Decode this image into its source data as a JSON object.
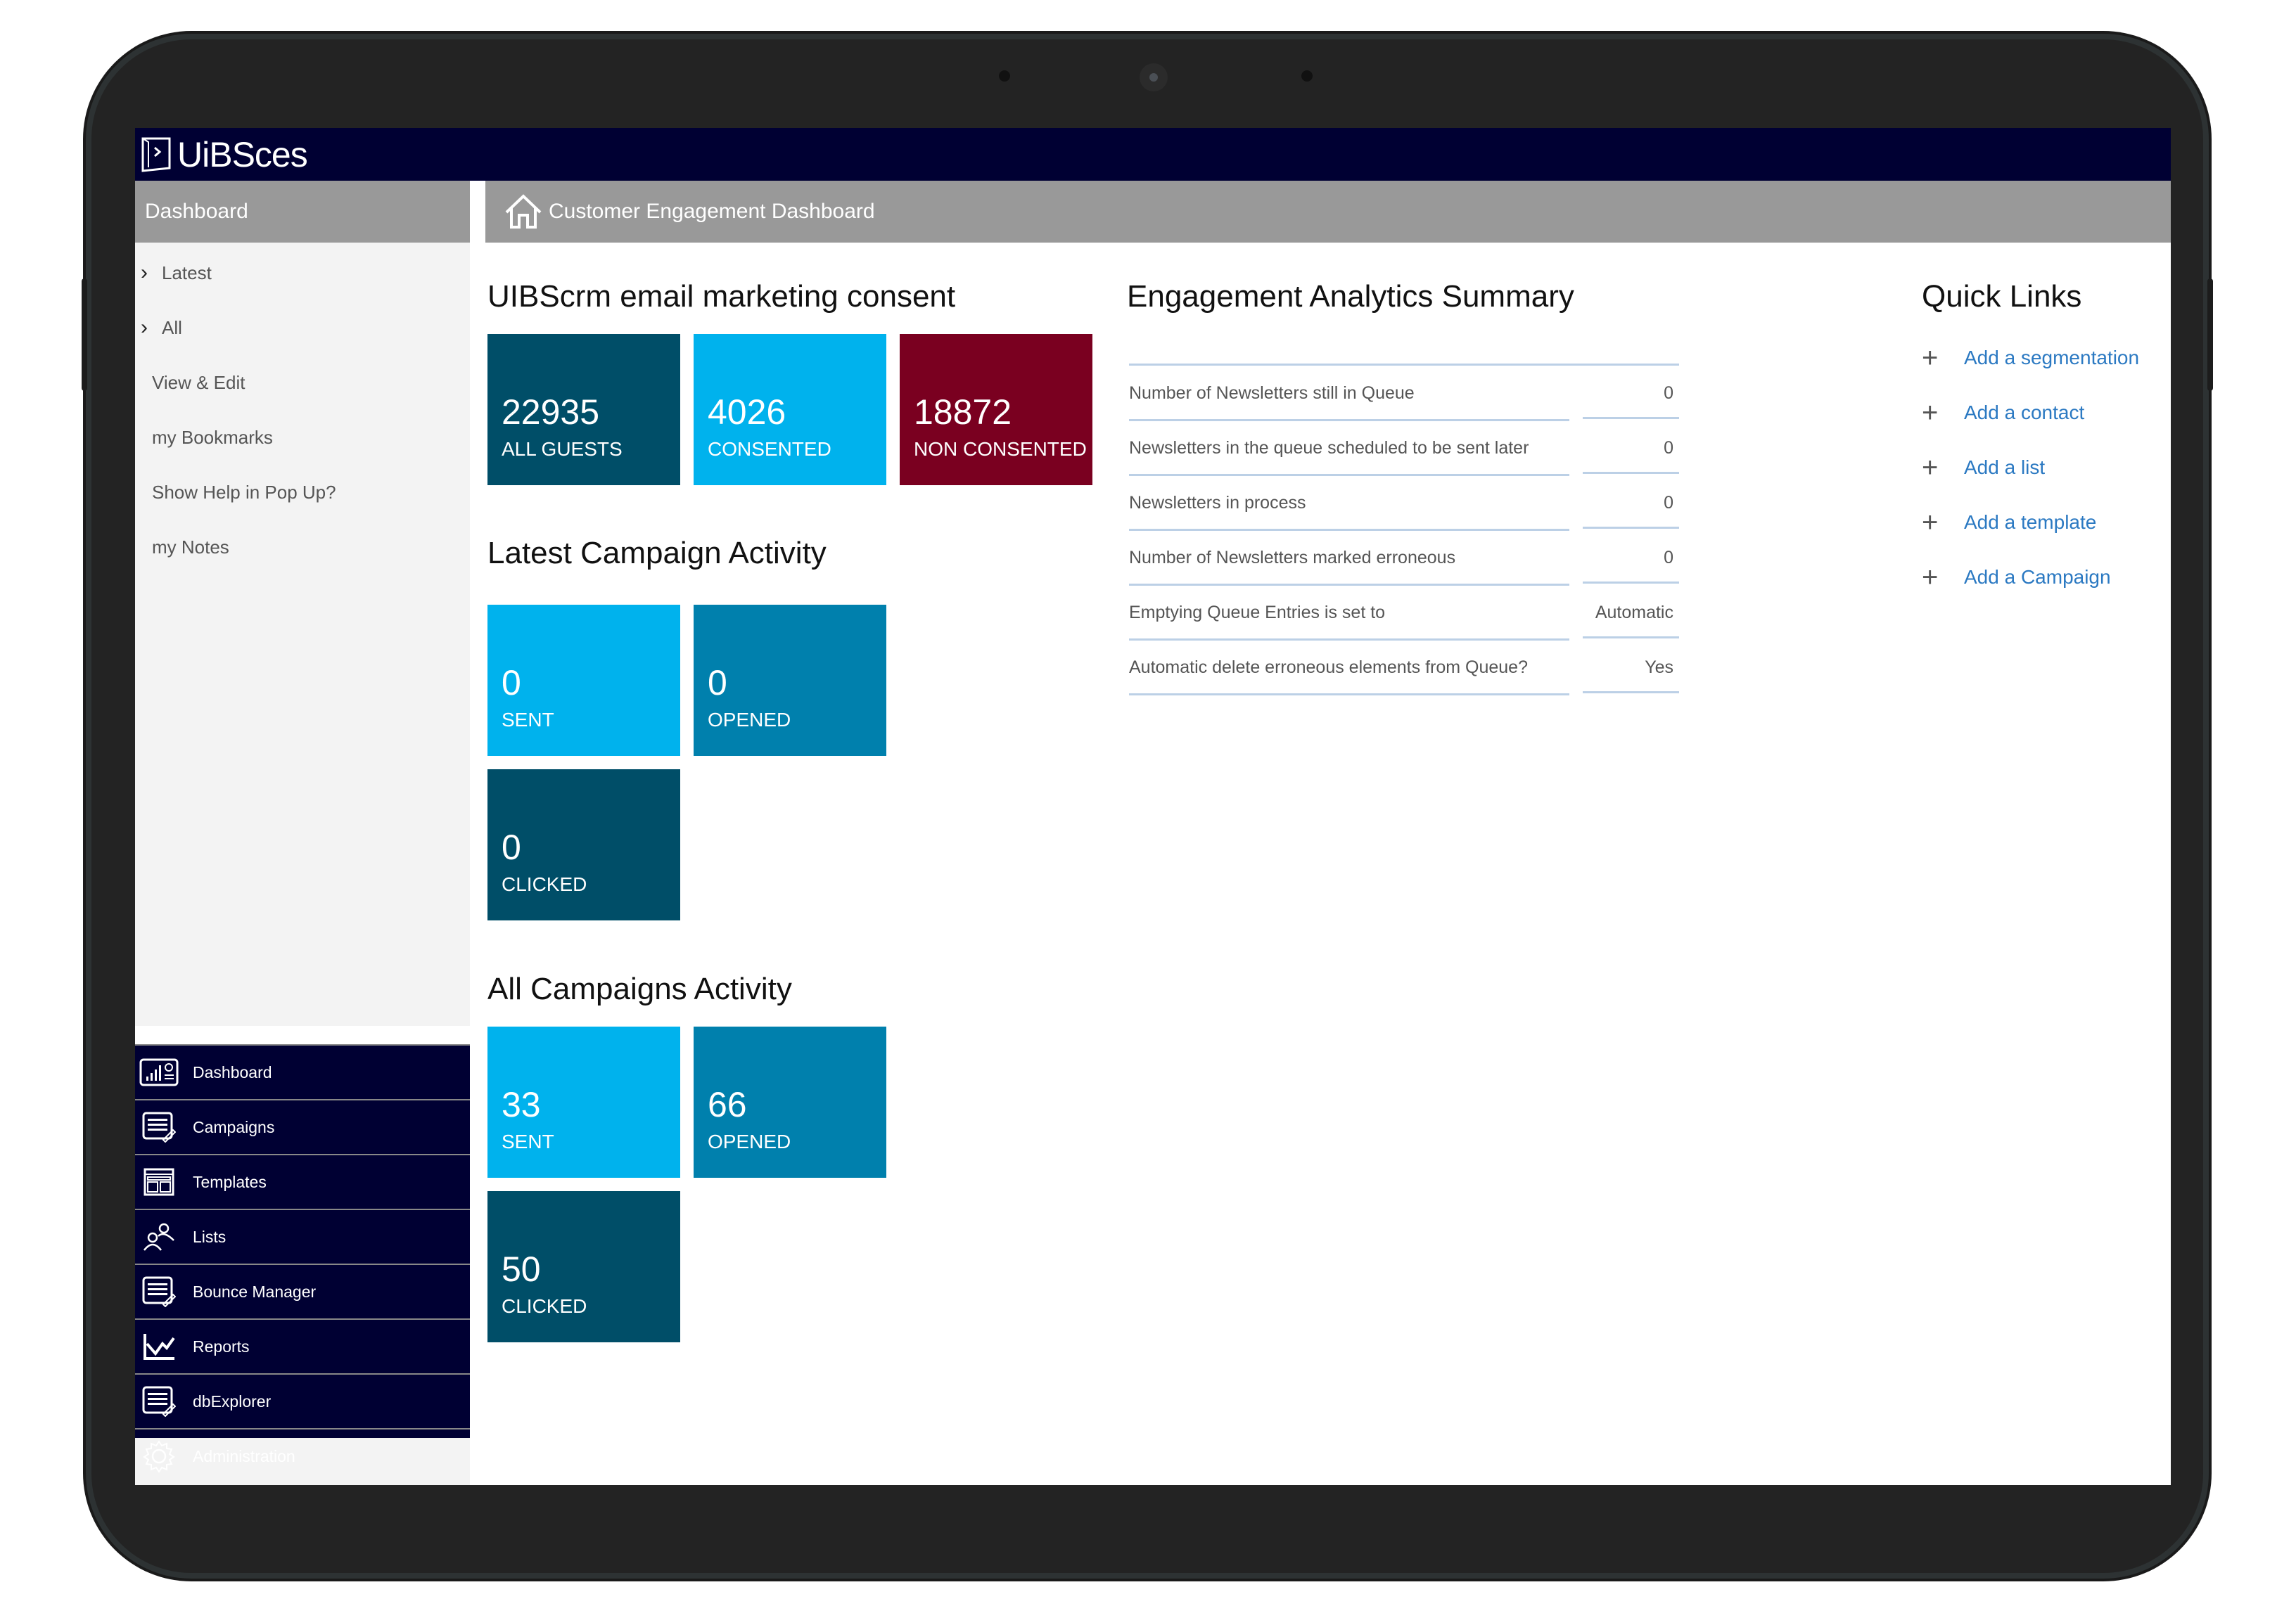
{
  "app": {
    "logo_text": "UiBSces"
  },
  "sidebar": {
    "header": "Dashboard",
    "menu": [
      {
        "label": "Latest",
        "expandable": true
      },
      {
        "label": "All",
        "expandable": true
      },
      {
        "label": "View & Edit",
        "expandable": false
      },
      {
        "label": "my Bookmarks",
        "expandable": false
      },
      {
        "label": "Show Help in Pop Up?",
        "expandable": false
      },
      {
        "label": "my Notes",
        "expandable": false
      }
    ],
    "nav": [
      {
        "label": "Dashboard",
        "icon": "dashboard-icon"
      },
      {
        "label": "Campaigns",
        "icon": "campaigns-icon"
      },
      {
        "label": "Templates",
        "icon": "templates-icon"
      },
      {
        "label": "Lists",
        "icon": "users-icon"
      },
      {
        "label": "Bounce Manager",
        "icon": "bounce-manager-icon"
      },
      {
        "label": "Reports",
        "icon": "line-chart-icon"
      },
      {
        "label": "dbExplorer",
        "icon": "db-explorer-icon"
      },
      {
        "label": "Administration",
        "icon": "gear-icon"
      }
    ]
  },
  "page_header": {
    "title": "Customer Engagement Dashboard",
    "icon": "home-icon"
  },
  "consent": {
    "title": "UIBScrm email marketing consent",
    "tiles": [
      {
        "value": "22935",
        "label": "ALL GUESTS",
        "color": "#004e68"
      },
      {
        "value": "4026",
        "label": "CONSENTED",
        "color": "#00b2ed"
      },
      {
        "value": "18872",
        "label": "NON CONSENTED",
        "color": "#7a0020"
      }
    ]
  },
  "latest_campaign": {
    "title": "Latest Campaign Activity",
    "tiles": [
      {
        "value": "0",
        "label": "SENT",
        "color": "#00b2ed"
      },
      {
        "value": "0",
        "label": "OPENED",
        "color": "#0080ad"
      },
      {
        "value": "0",
        "label": "CLICKED",
        "color": "#004e68"
      }
    ]
  },
  "all_campaigns": {
    "title": "All Campaigns Activity",
    "tiles": [
      {
        "value": "33",
        "label": "SENT",
        "color": "#00b2ed"
      },
      {
        "value": "66",
        "label": "OPENED",
        "color": "#0080ad"
      },
      {
        "value": "50",
        "label": "CLICKED",
        "color": "#004e68"
      }
    ]
  },
  "analytics": {
    "title": "Engagement Analytics Summary",
    "rows": [
      {
        "label": "Number of Newsletters still in Queue",
        "value": "0"
      },
      {
        "label": "Newsletters in the queue scheduled to be sent later",
        "value": "0"
      },
      {
        "label": "Newsletters in process",
        "value": "0"
      },
      {
        "label": "Number of Newsletters marked erroneous",
        "value": "0"
      },
      {
        "label": "Emptying Queue Entries is set to",
        "value": "Automatic"
      },
      {
        "label": "Automatic delete erroneous elements from Queue?",
        "value": "Yes"
      }
    ]
  },
  "quick_links": {
    "title": "Quick Links",
    "items": [
      {
        "label": "Add a segmentation"
      },
      {
        "label": "Add a contact"
      },
      {
        "label": "Add a list"
      },
      {
        "label": "Add a template"
      },
      {
        "label": "Add a Campaign"
      }
    ],
    "link_color": "#2b79c2"
  }
}
